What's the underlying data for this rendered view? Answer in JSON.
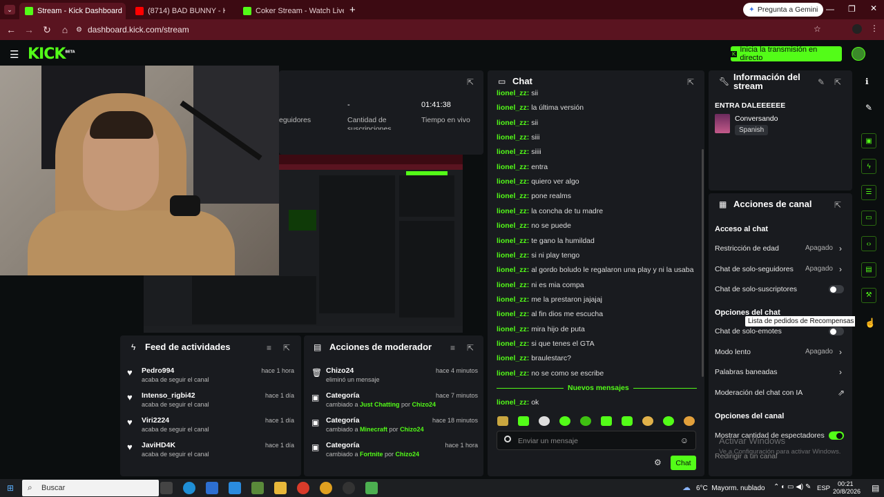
{
  "browser": {
    "tabs": [
      {
        "label": "Stream - Kick Dashboard",
        "active": true
      },
      {
        "label": "(8714) BAD BUNNY - KETU TeCi",
        "active": false
      },
      {
        "label": "Coker Stream - Watch Live",
        "active": false
      }
    ],
    "gemini_label": "Pregunta a Gemini",
    "url": "dashboard.kick.com/stream"
  },
  "header": {
    "brand": "KICK",
    "beta": "BETA",
    "go_live_label": "Inicia la transmisión en directo"
  },
  "stats": {
    "followers_label": "eguidores",
    "subs_value": "-",
    "subs_label": "Cantidad de suscripciones",
    "live_time_value": "01:41:38",
    "live_time_label": "Tiempo en vivo"
  },
  "chat": {
    "title": "Chat",
    "messages": [
      {
        "user": "lionel_zz:",
        "text": "sii"
      },
      {
        "user": "lionel_zz:",
        "text": "la última versión"
      },
      {
        "user": "lionel_zz:",
        "text": "sii"
      },
      {
        "user": "lionel_zz:",
        "text": "siii"
      },
      {
        "user": "lionel_zz:",
        "text": "siiii"
      },
      {
        "user": "lionel_zz:",
        "text": "entra"
      },
      {
        "user": "lionel_zz:",
        "text": "quiero ver algo"
      },
      {
        "user": "lionel_zz:",
        "text": "pone realms"
      },
      {
        "user": "lionel_zz:",
        "text": "la concha de tu madre"
      },
      {
        "user": "lionel_zz:",
        "text": "no se puede"
      },
      {
        "user": "lionel_zz:",
        "text": "te gano la humildad"
      },
      {
        "user": "lionel_zz:",
        "text": "si ni play tengo"
      },
      {
        "user": "lionel_zz:",
        "text": "al gordo boludo le regalaron una play y ni la usaba"
      },
      {
        "user": "lionel_zz:",
        "text": "ni es mia compa"
      },
      {
        "user": "lionel_zz:",
        "text": "me la prestaron jajajaj"
      },
      {
        "user": "lionel_zz:",
        "text": "al fin dios me escucha"
      },
      {
        "user": "lionel_zz:",
        "text": "mira hijo de puta"
      },
      {
        "user": "lionel_zz:",
        "text": "si que tenes el GTA"
      },
      {
        "user": "lionel_zz:",
        "text": "braulestarc?"
      },
      {
        "user": "lionel_zz:",
        "text": "no se como se escribe"
      }
    ],
    "new_messages_label": "Nuevos mensajes",
    "last_message": {
      "user": "lionel_zz:",
      "text": "ok"
    },
    "input_placeholder": "Enviar un mensaje",
    "send_label": "Chat"
  },
  "activity": {
    "title": "Feed de actividades",
    "items": [
      {
        "name": "Pedro994",
        "sub": "acaba de seguir el canal",
        "time": "hace 1 hora"
      },
      {
        "name": "Intenso_rigbi42",
        "sub": "acaba de seguir el canal",
        "time": "hace 1 día"
      },
      {
        "name": "Viri2224",
        "sub": "acaba de seguir el canal",
        "time": "hace 1 día"
      },
      {
        "name": "JaviHD4K",
        "sub": "acaba de seguir el canal",
        "time": "hace 1 día"
      }
    ]
  },
  "mod": {
    "title": "Acciones de moderador",
    "items": [
      {
        "name": "Chizo24",
        "pre": "eliminó un mensaje",
        "hl": "",
        "mid": "",
        "by": "",
        "time": "hace 4 minutos"
      },
      {
        "name": "Categoría",
        "pre": "cambiado a ",
        "hl": "Just Chatting",
        "mid": " por ",
        "by": "Chizo24",
        "time": "hace 7 minutos"
      },
      {
        "name": "Categoría",
        "pre": "cambiado a ",
        "hl": "Minecraft",
        "mid": " por ",
        "by": "Chizo24",
        "time": "hace 18 minutos"
      },
      {
        "name": "Categoría",
        "pre": "cambiado a ",
        "hl": "Fortnite",
        "mid": " por ",
        "by": "Chizo24",
        "time": "hace 1 hora"
      }
    ]
  },
  "info": {
    "title": "Información del stream",
    "stream_title": "ENTRA DALEEEEEE",
    "category": "Conversando",
    "language": "Spanish"
  },
  "channel_actions": {
    "title": "Acciones de canal",
    "chat_access": "Acceso al chat",
    "rows": [
      {
        "label": "Restricción de edad",
        "value": "Apagado",
        "kind": "arrow"
      },
      {
        "label": "Chat de solo-seguidores",
        "value": "Apagado",
        "kind": "arrow"
      },
      {
        "label": "Chat de solo-suscriptores",
        "value": "",
        "kind": "toggle"
      }
    ],
    "chat_options": "Opciones del chat",
    "tooltip": "Lista de pedidos de Recompensas",
    "rows2": [
      {
        "label": "Chat de solo-emotes",
        "value": "",
        "kind": "toggle"
      },
      {
        "label": "Modo lento",
        "value": "Apagado",
        "kind": "arrow"
      },
      {
        "label": "Palabras baneadas",
        "value": "",
        "kind": "arrow"
      },
      {
        "label": "Moderación del chat con IA",
        "value": "",
        "kind": "external"
      }
    ],
    "channel_options": "Opciones del canal",
    "show_viewers": "Mostrar cantidad de espectadores",
    "raid": "Redirigir a un canal"
  },
  "watermark": {
    "title": "Activar Windows",
    "sub": "Ve a Configuración para activar Windows."
  },
  "taskbar": {
    "search": "Buscar",
    "weather": "6°C  Mayorm. nublado",
    "lang": "ESP",
    "time": "00:21",
    "date": "20/8/2026"
  },
  "colors": {
    "accent": "#53fc18",
    "panel": "#191b1f",
    "bg": "#0b0e0f",
    "tabbar": "#3c0a12"
  }
}
